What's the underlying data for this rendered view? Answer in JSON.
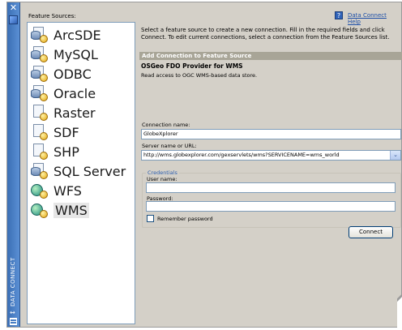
{
  "palette": {
    "close_glyph": "✕",
    "title": "DATA CONNECT",
    "arrows_glyph": "↔"
  },
  "sources": {
    "label": "Feature Sources:",
    "items": [
      {
        "label": "ArcSDE",
        "icon": "database-plug-icon",
        "kind": "db"
      },
      {
        "label": "MySQL",
        "icon": "database-plug-icon",
        "kind": "db"
      },
      {
        "label": "ODBC",
        "icon": "database-plug-icon",
        "kind": "db"
      },
      {
        "label": "Oracle",
        "icon": "database-plug-icon",
        "kind": "db"
      },
      {
        "label": "Raster",
        "icon": "file-plug-icon",
        "kind": "file"
      },
      {
        "label": "SDF",
        "icon": "file-plug-icon",
        "kind": "file"
      },
      {
        "label": "SHP",
        "icon": "file-plug-icon",
        "kind": "file"
      },
      {
        "label": "SQL Server",
        "icon": "database-plug-icon",
        "kind": "db"
      },
      {
        "label": "WFS",
        "icon": "globe-plug-icon",
        "kind": "web"
      },
      {
        "label": "WMS",
        "icon": "globe-plug-icon",
        "kind": "web",
        "selected": true
      }
    ]
  },
  "help": {
    "icon_glyph": "?",
    "link": "Data Connect Help"
  },
  "instructions": "Select a feature source to create a new connection. Fill in the required fields and click Connect. To edit current connections, select a connection from the Feature Sources list.",
  "section": {
    "title": "Add Connection to Feature Source",
    "provider_name": "OSGeo FDO Provider for WMS",
    "provider_desc": "Read access to OGC WMS-based data store."
  },
  "form": {
    "connection_name_label": "Connection name:",
    "connection_name_value": "GlobeXplorer",
    "server_label": "Server name or URL:",
    "server_value": "http://wms.globexplorer.com/gexservlets/wms?SERVICENAME=wms_world",
    "credentials_legend": "Credentials",
    "username_label": "User name:",
    "username_value": "",
    "password_label": "Password:",
    "password_value": "",
    "remember_label": "Remember password",
    "connect_label": "Connect"
  },
  "colors": {
    "palette_bar": "#3b6fb5",
    "section_bar": "#a8a597",
    "link": "#1d4fa8"
  }
}
